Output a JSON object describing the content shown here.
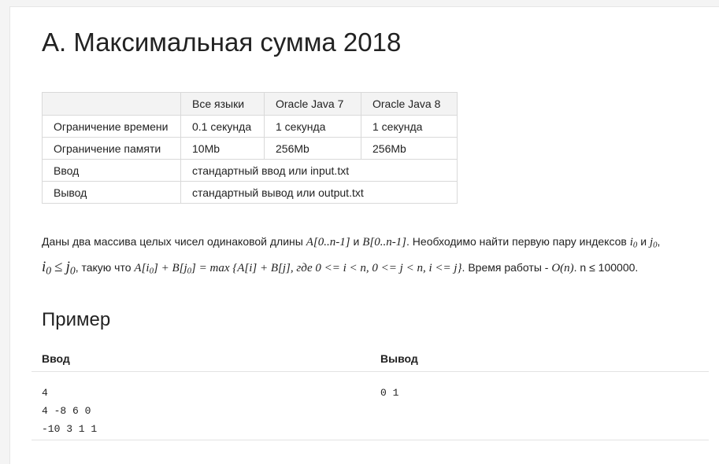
{
  "problem": {
    "title": "A. Максимальная сумма 2018"
  },
  "limits": {
    "headers": [
      "",
      "Все языки",
      "Oracle Java 7",
      "Oracle Java 8"
    ],
    "time_label": "Ограничение времени",
    "time_values": [
      "0.1 секунда",
      "1 секунда",
      "1 секунда"
    ],
    "memory_label": "Ограничение памяти",
    "memory_values": [
      "10Mb",
      "256Mb",
      "256Mb"
    ],
    "input_label": "Ввод",
    "input_value": "стандартный ввод или input.txt",
    "output_label": "Вывод",
    "output_value": "стандартный вывод или output.txt"
  },
  "statement": {
    "t1": "Даны два массива целых чисел одинаковой длины ",
    "m_a": "A[0..n-1]",
    "t2": " и ",
    "m_b": "B[0..n-1]",
    "t3": ". Необходимо найти первую пару индексов ",
    "i_base": "i",
    "idx0": "0",
    "t4": " и ",
    "j_base": "j",
    "t5": ",",
    "le": "≤",
    "t6": ", такую что ",
    "m_expr": "A[i",
    "m_expr2": "] + B[j",
    "m_expr3": "] = max {A[i] + B[j], где 0 <= i < n, 0 <= j < n, i <= j}",
    "t7": ". Время работы - ",
    "m_time": "O(n)",
    "t8": ". n ≤ 100000."
  },
  "example": {
    "title": "Пример",
    "input_header": "Ввод",
    "output_header": "Вывод",
    "input_text": "4\n4 -8 6 0\n-10 3 1 1",
    "output_text": "0 1"
  }
}
